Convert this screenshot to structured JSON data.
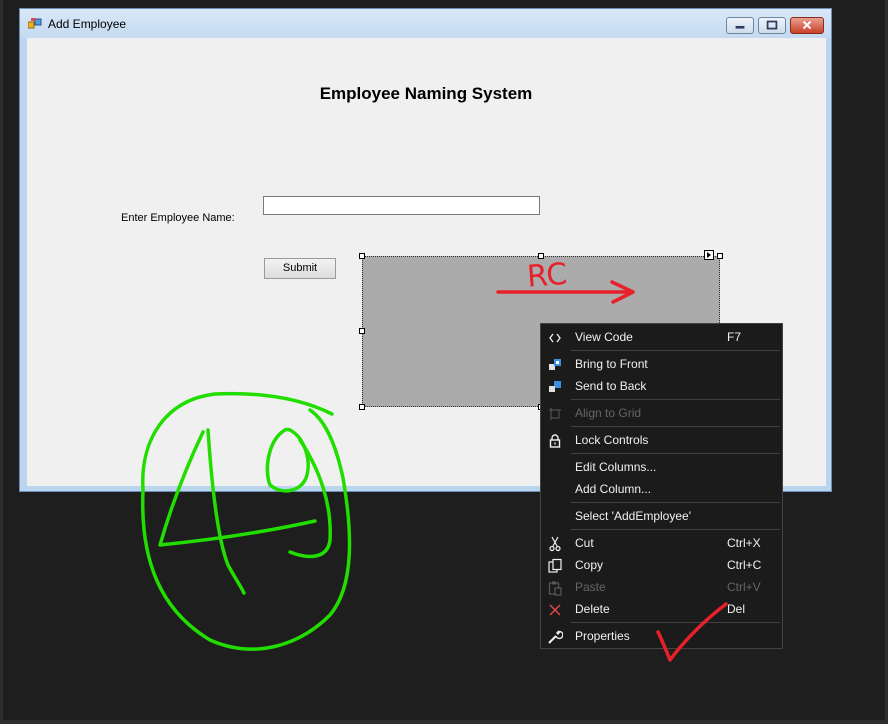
{
  "window": {
    "title": "Add Employee"
  },
  "form": {
    "heading": "Employee Naming System",
    "name_label": "Enter Employee Name:",
    "name_value": "",
    "submit_label": "Submit"
  },
  "context_menu": {
    "items": [
      {
        "icon": "code-icon",
        "label": "View Code",
        "shortcut": "F7",
        "enabled": true
      },
      {
        "icon": "bring-to-front-icon",
        "label": "Bring to Front",
        "shortcut": "",
        "enabled": true
      },
      {
        "icon": "send-to-back-icon",
        "label": "Send to Back",
        "shortcut": "",
        "enabled": true
      },
      {
        "icon": "align-grid-icon",
        "label": "Align to Grid",
        "shortcut": "",
        "enabled": false
      },
      {
        "icon": "lock-icon",
        "label": "Lock Controls",
        "shortcut": "",
        "enabled": true
      },
      {
        "icon": "",
        "label": "Edit Columns...",
        "shortcut": "",
        "enabled": true
      },
      {
        "icon": "",
        "label": "Add Column...",
        "shortcut": "",
        "enabled": true
      },
      {
        "icon": "",
        "label": "Select 'AddEmployee'",
        "shortcut": "",
        "enabled": true
      },
      {
        "icon": "scissors-icon",
        "label": "Cut",
        "shortcut": "Ctrl+X",
        "enabled": true
      },
      {
        "icon": "copy-icon",
        "label": "Copy",
        "shortcut": "Ctrl+C",
        "enabled": true
      },
      {
        "icon": "paste-icon",
        "label": "Paste",
        "shortcut": "Ctrl+V",
        "enabled": false
      },
      {
        "icon": "delete-icon",
        "label": "Delete",
        "shortcut": "Del",
        "enabled": true
      },
      {
        "icon": "wrench-icon",
        "label": "Properties",
        "shortcut": "",
        "enabled": true
      }
    ]
  },
  "annotations": {
    "arrow_text": "RC",
    "circled_number": "40",
    "red_color": "#e8202a",
    "green_color": "#22dd00"
  },
  "colors": {
    "ide_background": "#1e1e1e",
    "menu_background": "#1b1b1c",
    "form_background": "#f0f0f0",
    "grid_placeholder": "#ababab"
  }
}
